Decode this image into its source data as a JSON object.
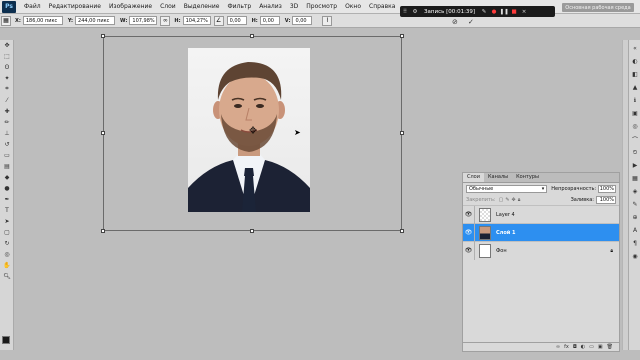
{
  "menubar": {
    "logo": "Ps",
    "items": [
      "Файл",
      "Редактирование",
      "Изображение",
      "Слои",
      "Выделение",
      "Фильтр",
      "Анализ",
      "3D",
      "Просмотр",
      "Окно",
      "Справка"
    ],
    "workspace": "Основная рабочая среда"
  },
  "recorder": {
    "label": "Запись [00:01:39]"
  },
  "options": {
    "x_label": "X:",
    "x_value": "186,00 пикс",
    "y_label": "Y:",
    "y_value": "244,00 пикс",
    "w_label": "W:",
    "w_value": "107,98%",
    "h_label": "H:",
    "h_value": "104,27%",
    "angle_value": "0,00",
    "h_skew_label": "H:",
    "h_skew_value": "0,00",
    "v_label": "V:",
    "v_value": "0,00"
  },
  "layers": {
    "tabs": [
      "Слои",
      "Каналы",
      "Контуры"
    ],
    "blend_mode": "Обычные",
    "opacity_label": "Непрозрачность:",
    "opacity_value": "100%",
    "lock_label": "Закрепить:",
    "fill_label": "Заливка:",
    "fill_value": "100%",
    "items": [
      {
        "name": "Layer 4"
      },
      {
        "name": "Слой 1"
      },
      {
        "name": "Фон"
      }
    ],
    "footer_icons": [
      "link-icon",
      "fx-icon",
      "mask-icon",
      "adjustment-icon",
      "folder-icon",
      "new-layer-icon",
      "trash-icon"
    ]
  },
  "colors": {
    "accent": "#2d8ff0",
    "canvas_bg": "#bdbdbd",
    "panel": "#d9d9d9"
  }
}
